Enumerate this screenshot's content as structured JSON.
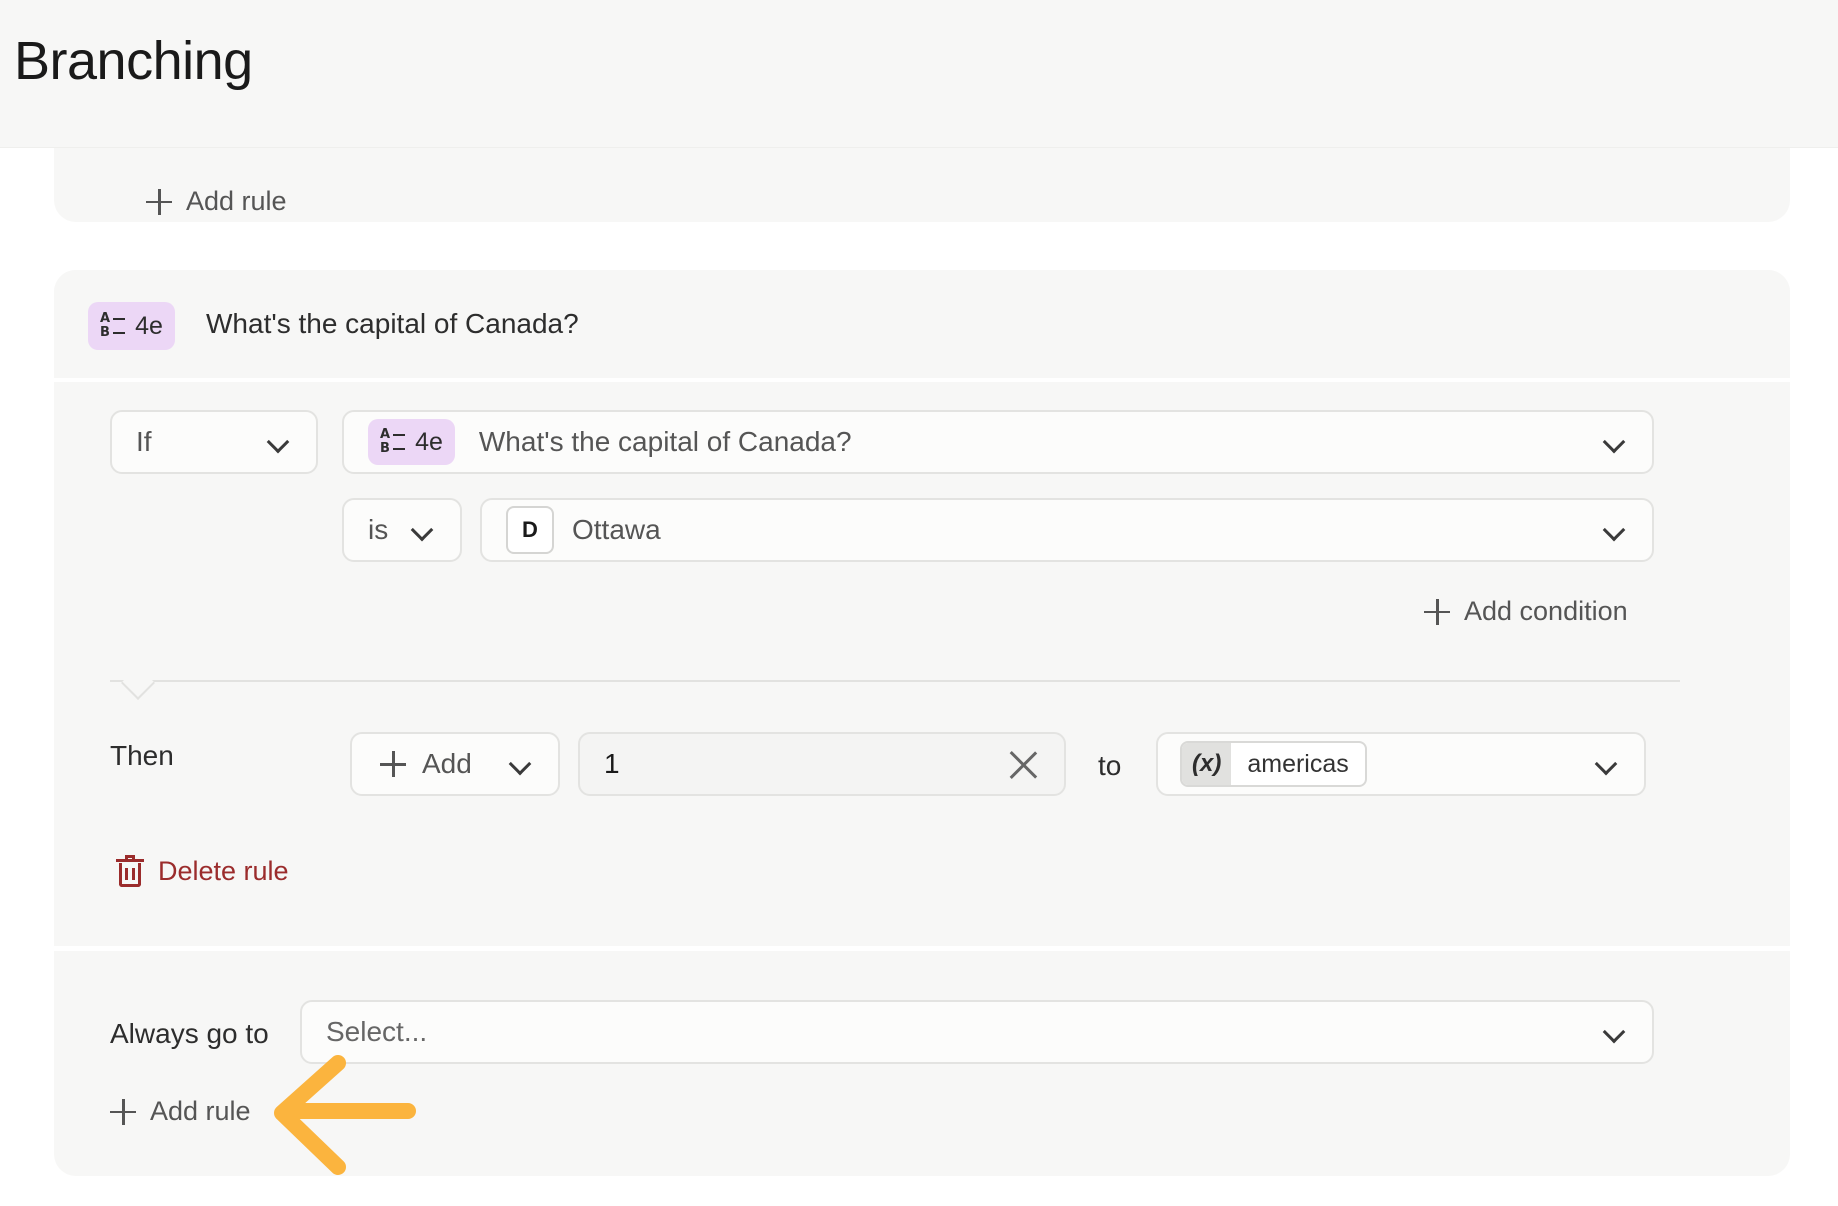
{
  "header": {
    "title": "Branching"
  },
  "top_card": {
    "add_rule_label": "Add rule"
  },
  "question": {
    "badge": "4e",
    "title": "What's the capital of Canada?"
  },
  "rule": {
    "if_label": "If",
    "field_badge": "4e",
    "field_value": "What's the capital of Canada?",
    "operator": "is",
    "answer_letter": "D",
    "answer_value": "Ottawa",
    "add_condition_label": "Add condition",
    "then_label": "Then",
    "action_label": "Add",
    "amount_value": "1",
    "to_label": "to",
    "variable_icon": "(x)",
    "variable_name": "americas",
    "delete_label": "Delete rule"
  },
  "always": {
    "label": "Always go to",
    "placeholder": "Select...",
    "add_rule_label": "Add rule"
  },
  "colors": {
    "card_bg": "#f7f7f6",
    "badge_bg": "#ecd7f6",
    "delete_red": "#9b2c2c",
    "arrow_orange": "#fbb43e"
  },
  "icons": [
    "plus-icon",
    "chevron-down-icon",
    "choice-list-icon",
    "close-icon",
    "trash-icon",
    "variable-icon",
    "arrow-annotation-icon"
  ]
}
